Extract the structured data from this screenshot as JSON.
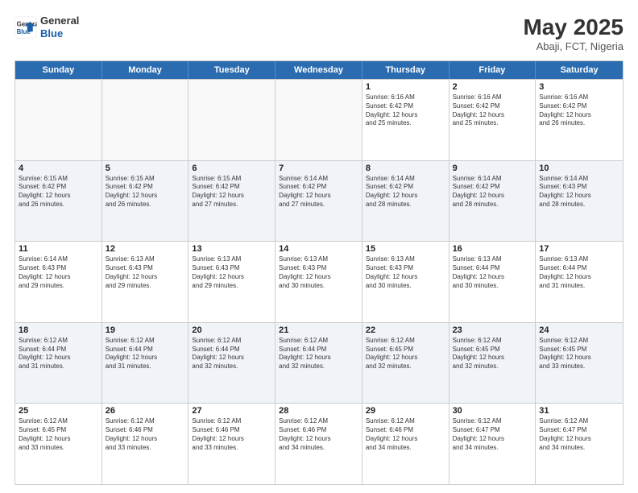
{
  "logo": {
    "line1": "General",
    "line2": "Blue"
  },
  "title": {
    "month_year": "May 2025",
    "location": "Abaji, FCT, Nigeria"
  },
  "header_days": [
    "Sunday",
    "Monday",
    "Tuesday",
    "Wednesday",
    "Thursday",
    "Friday",
    "Saturday"
  ],
  "rows": [
    [
      {
        "day": "",
        "detail": "",
        "empty": true
      },
      {
        "day": "",
        "detail": "",
        "empty": true
      },
      {
        "day": "",
        "detail": "",
        "empty": true
      },
      {
        "day": "",
        "detail": "",
        "empty": true
      },
      {
        "day": "1",
        "detail": "Sunrise: 6:16 AM\nSunset: 6:42 PM\nDaylight: 12 hours\nand 25 minutes."
      },
      {
        "day": "2",
        "detail": "Sunrise: 6:16 AM\nSunset: 6:42 PM\nDaylight: 12 hours\nand 25 minutes."
      },
      {
        "day": "3",
        "detail": "Sunrise: 6:16 AM\nSunset: 6:42 PM\nDaylight: 12 hours\nand 26 minutes."
      }
    ],
    [
      {
        "day": "4",
        "detail": "Sunrise: 6:15 AM\nSunset: 6:42 PM\nDaylight: 12 hours\nand 26 minutes."
      },
      {
        "day": "5",
        "detail": "Sunrise: 6:15 AM\nSunset: 6:42 PM\nDaylight: 12 hours\nand 26 minutes."
      },
      {
        "day": "6",
        "detail": "Sunrise: 6:15 AM\nSunset: 6:42 PM\nDaylight: 12 hours\nand 27 minutes."
      },
      {
        "day": "7",
        "detail": "Sunrise: 6:14 AM\nSunset: 6:42 PM\nDaylight: 12 hours\nand 27 minutes."
      },
      {
        "day": "8",
        "detail": "Sunrise: 6:14 AM\nSunset: 6:42 PM\nDaylight: 12 hours\nand 28 minutes."
      },
      {
        "day": "9",
        "detail": "Sunrise: 6:14 AM\nSunset: 6:42 PM\nDaylight: 12 hours\nand 28 minutes."
      },
      {
        "day": "10",
        "detail": "Sunrise: 6:14 AM\nSunset: 6:43 PM\nDaylight: 12 hours\nand 28 minutes."
      }
    ],
    [
      {
        "day": "11",
        "detail": "Sunrise: 6:14 AM\nSunset: 6:43 PM\nDaylight: 12 hours\nand 29 minutes."
      },
      {
        "day": "12",
        "detail": "Sunrise: 6:13 AM\nSunset: 6:43 PM\nDaylight: 12 hours\nand 29 minutes."
      },
      {
        "day": "13",
        "detail": "Sunrise: 6:13 AM\nSunset: 6:43 PM\nDaylight: 12 hours\nand 29 minutes."
      },
      {
        "day": "14",
        "detail": "Sunrise: 6:13 AM\nSunset: 6:43 PM\nDaylight: 12 hours\nand 30 minutes."
      },
      {
        "day": "15",
        "detail": "Sunrise: 6:13 AM\nSunset: 6:43 PM\nDaylight: 12 hours\nand 30 minutes."
      },
      {
        "day": "16",
        "detail": "Sunrise: 6:13 AM\nSunset: 6:44 PM\nDaylight: 12 hours\nand 30 minutes."
      },
      {
        "day": "17",
        "detail": "Sunrise: 6:13 AM\nSunset: 6:44 PM\nDaylight: 12 hours\nand 31 minutes."
      }
    ],
    [
      {
        "day": "18",
        "detail": "Sunrise: 6:12 AM\nSunset: 6:44 PM\nDaylight: 12 hours\nand 31 minutes."
      },
      {
        "day": "19",
        "detail": "Sunrise: 6:12 AM\nSunset: 6:44 PM\nDaylight: 12 hours\nand 31 minutes."
      },
      {
        "day": "20",
        "detail": "Sunrise: 6:12 AM\nSunset: 6:44 PM\nDaylight: 12 hours\nand 32 minutes."
      },
      {
        "day": "21",
        "detail": "Sunrise: 6:12 AM\nSunset: 6:44 PM\nDaylight: 12 hours\nand 32 minutes."
      },
      {
        "day": "22",
        "detail": "Sunrise: 6:12 AM\nSunset: 6:45 PM\nDaylight: 12 hours\nand 32 minutes."
      },
      {
        "day": "23",
        "detail": "Sunrise: 6:12 AM\nSunset: 6:45 PM\nDaylight: 12 hours\nand 32 minutes."
      },
      {
        "day": "24",
        "detail": "Sunrise: 6:12 AM\nSunset: 6:45 PM\nDaylight: 12 hours\nand 33 minutes."
      }
    ],
    [
      {
        "day": "25",
        "detail": "Sunrise: 6:12 AM\nSunset: 6:45 PM\nDaylight: 12 hours\nand 33 minutes."
      },
      {
        "day": "26",
        "detail": "Sunrise: 6:12 AM\nSunset: 6:46 PM\nDaylight: 12 hours\nand 33 minutes."
      },
      {
        "day": "27",
        "detail": "Sunrise: 6:12 AM\nSunset: 6:46 PM\nDaylight: 12 hours\nand 33 minutes."
      },
      {
        "day": "28",
        "detail": "Sunrise: 6:12 AM\nSunset: 6:46 PM\nDaylight: 12 hours\nand 34 minutes."
      },
      {
        "day": "29",
        "detail": "Sunrise: 6:12 AM\nSunset: 6:46 PM\nDaylight: 12 hours\nand 34 minutes."
      },
      {
        "day": "30",
        "detail": "Sunrise: 6:12 AM\nSunset: 6:47 PM\nDaylight: 12 hours\nand 34 minutes."
      },
      {
        "day": "31",
        "detail": "Sunrise: 6:12 AM\nSunset: 6:47 PM\nDaylight: 12 hours\nand 34 minutes."
      }
    ]
  ]
}
